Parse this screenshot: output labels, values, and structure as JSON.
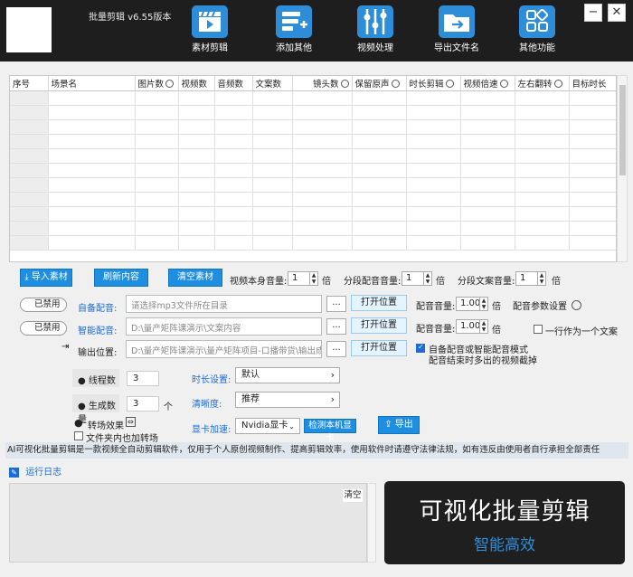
{
  "header": {
    "title": "批量剪辑 v6.55版本",
    "toolbar": [
      {
        "label": "素材剪辑",
        "icon": "clapperboard-icon"
      },
      {
        "label": "添加其他",
        "icon": "list-add-icon"
      },
      {
        "label": "视频处理",
        "icon": "sliders-icon"
      },
      {
        "label": "导出文件名",
        "icon": "folder-export-icon"
      },
      {
        "label": "其他功能",
        "icon": "apps-grid-icon"
      }
    ],
    "minimize": "−",
    "close": "✕"
  },
  "table": {
    "columns": [
      "序号",
      "场景名",
      "图片数",
      "视频数",
      "音频数",
      "文案数",
      "镜头数",
      "保留原声",
      "时长剪辑",
      "视频倍速",
      "左右翻转",
      "目标时长"
    ],
    "row_count": 11
  },
  "actions": {
    "import": "导入素材",
    "refresh": "刷新内容",
    "clear": "清空素材"
  },
  "volumes": {
    "video_label": "视频本身音量:",
    "video_value": "1",
    "video_unit": "倍",
    "segment_label": "分段配音音量:",
    "segment_value": "1",
    "segment_unit": "倍",
    "text_label": "分段文案音量:",
    "text_value": "1",
    "text_unit": "倍"
  },
  "dubbing": {
    "toggle": "已禁用",
    "label": "自备配音:",
    "placeholder": "请选择mp3文件所在目录",
    "dots": "...",
    "open": "打开位置",
    "vol_label": "配音音量:",
    "vol_value": "1.00",
    "vol_unit": "倍",
    "settings": "配音参数设置"
  },
  "smart": {
    "toggle": "已禁用",
    "label": "智能配音:",
    "path": "D:\\量产矩阵课演示\\文案内容",
    "dots": "...",
    "open": "打开位置",
    "vol_label": "配音音量:",
    "vol_value": "1.00",
    "vol_unit": "倍",
    "one_line": "一行作为一个文案"
  },
  "output": {
    "label": "输出位置:",
    "path": "D:\\量产矩阵课演示\\量产矩阵项目-口播带货\\输出成品\\",
    "dots": "...",
    "open": "打开位置",
    "mode_line1": "自备配音或智能配音模式",
    "mode_line2": "配音结束时多出的视频截掉"
  },
  "options": {
    "threads_label": "线程数",
    "threads_value": "3",
    "count_label": "生成数量",
    "count_value": "3",
    "count_unit": "个",
    "transition": "转场效果",
    "folder_transition": "文件夹内也加转场",
    "duration_label": "时长设置:",
    "duration_value": "默认",
    "clarity_label": "清晰度:",
    "clarity_value": "推荐",
    "gpu_label": "显卡加速:",
    "gpu_value": "Nvidia显卡",
    "detect": "检测本机显卡",
    "export": "导出"
  },
  "notice": "AI可视化批量剪辑是一款视频全自动剪辑软件，仅用于个人原创视频制作、提高剪辑效率，使用软件时请遵守法律法规，如有违反由使用者自行承担全部责任",
  "log": {
    "title": "运行日志",
    "clear": "清空"
  },
  "promo": {
    "line1": "可视化批量剪辑",
    "line2": "智能高效"
  }
}
